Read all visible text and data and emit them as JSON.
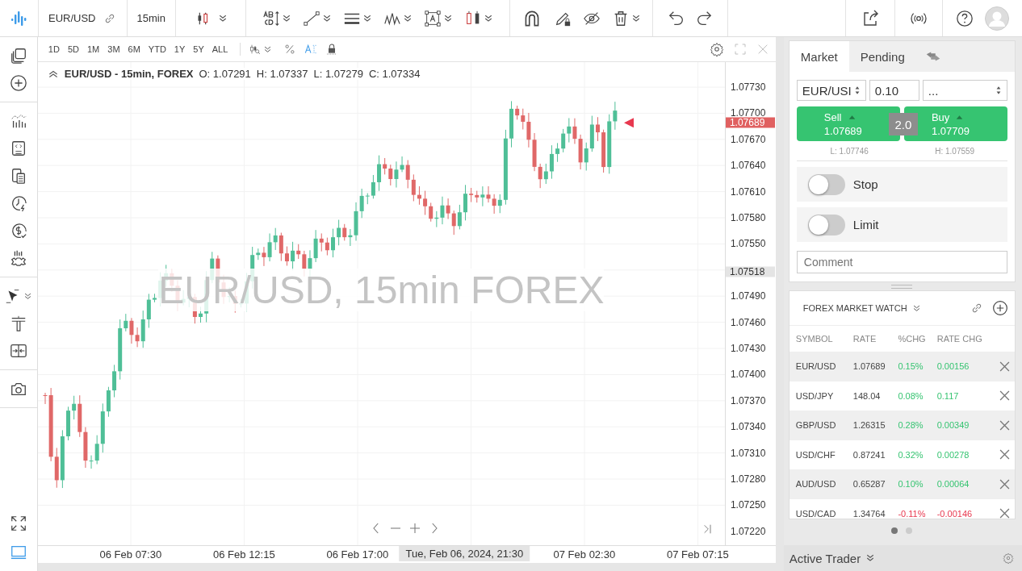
{
  "toolbar": {
    "symbol": "EUR/USD",
    "interval": "15min"
  },
  "range_buttons": [
    "1D",
    "5D",
    "1M",
    "3M",
    "6M",
    "YTD",
    "1Y",
    "5Y",
    "ALL"
  ],
  "chart": {
    "legend_title": "EUR/USD - 15min, FOREX",
    "ohlc": [
      "O: 1.07291",
      "H: 1.07337",
      "L: 1.07279",
      "C: 1.07334"
    ],
    "watermark": "EUR/USD, 15min FOREX",
    "price_ticks": [
      "1.07730",
      "1.07700",
      "1.07670",
      "1.07640",
      "1.07610",
      "1.07580",
      "1.07550",
      "1.07490",
      "1.07460",
      "1.07430",
      "1.07400",
      "1.07370",
      "1.07340",
      "1.07310",
      "1.07280",
      "1.07250",
      "1.07220"
    ],
    "last_price": "1.07689",
    "marker_price": "1.07518",
    "time_axis": [
      {
        "kind": "tick",
        "label": "06 Feb 07:30"
      },
      {
        "kind": "tick",
        "label": "06 Feb 12:15"
      },
      {
        "kind": "tick",
        "label": "06 Feb 17:00"
      },
      {
        "kind": "crosshair",
        "label": "Tue, Feb 06, 2024, 21:30"
      },
      {
        "kind": "tick",
        "label": "07 Feb 02:30"
      },
      {
        "kind": "tick",
        "label": "07 Feb 07:15"
      }
    ]
  },
  "order": {
    "tabs": [
      {
        "label": "Market",
        "selected": true
      },
      {
        "label": "Pending",
        "selected": false
      }
    ],
    "symbol": "EUR/USI",
    "quantity": "0.10",
    "type": "...",
    "sell": {
      "label": "Sell",
      "price": "1.07689"
    },
    "spread": "2.0",
    "buy": {
      "label": "Buy",
      "price": "1.07709"
    },
    "low": "L: 1.07746",
    "high": "H: 1.07559",
    "toggles": [
      {
        "label": "Stop",
        "on": false
      },
      {
        "label": "Limit",
        "on": false
      }
    ],
    "comment_placeholder": "Comment"
  },
  "watch": {
    "title": "FOREX MARKET WATCH",
    "columns": [
      "SYMBOL",
      "RATE",
      "%CHG",
      "RATE CHG"
    ],
    "rows": [
      {
        "symbol": "EUR/USD",
        "rate": "1.07689",
        "pct_chg": "0.15%",
        "rate_chg": "0.00156",
        "color": "#36c471"
      },
      {
        "symbol": "USD/JPY",
        "rate": "148.04",
        "pct_chg": "0.08%",
        "rate_chg": "0.117",
        "color": "#36c471"
      },
      {
        "symbol": "GBP/USD",
        "rate": "1.26315",
        "pct_chg": "0.28%",
        "rate_chg": "0.00349",
        "color": "#36c471"
      },
      {
        "symbol": "USD/CHF",
        "rate": "0.87241",
        "pct_chg": "0.32%",
        "rate_chg": "0.00278",
        "color": "#36c471"
      },
      {
        "symbol": "AUD/USD",
        "rate": "0.65287",
        "pct_chg": "0.10%",
        "rate_chg": "0.00064",
        "color": "#36c471"
      },
      {
        "symbol": "USD/CAD",
        "rate": "1.34764",
        "pct_chg": "-0.11%",
        "rate_chg": "-0.00146",
        "color": "#e8384f"
      }
    ]
  },
  "page_dots": [
    {
      "selected": true
    },
    {
      "selected": false
    }
  ],
  "footer": {
    "title": "Active Trader"
  }
}
